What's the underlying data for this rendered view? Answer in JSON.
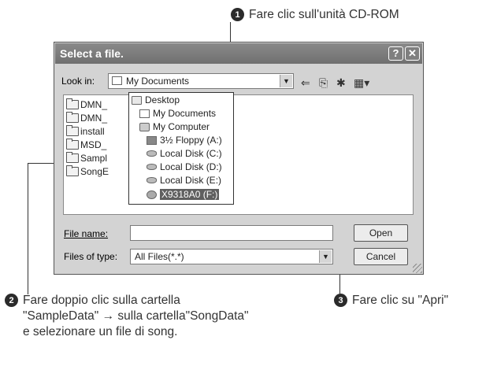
{
  "callouts": [
    {
      "num": "1",
      "text": "Fare clic sull'unità CD-ROM"
    },
    {
      "num": "2",
      "text": "Fare doppio clic sulla cartella \"SampleData\" → sulla cartella\"SongData\" e selezionare un file di song."
    },
    {
      "num": "3",
      "text": "Fare clic su \"Apri\""
    }
  ],
  "dialog": {
    "title": "Select a file.",
    "help_button": "?",
    "close_button": "✕",
    "look_in_label": "Look in:",
    "look_in_value": "My Documents",
    "file_name_label": "File name:",
    "file_name_value": "",
    "files_of_type_label": "Files of type:",
    "files_of_type_value": "All Files(*.*)",
    "open_button": "Open",
    "cancel_button": "Cancel"
  },
  "folders": [
    "DMN_",
    "DMN_",
    "install",
    "MSD_",
    "Sampl",
    "SongE"
  ],
  "dropdown_items": [
    {
      "label": "Desktop",
      "icon": "desktop-icon"
    },
    {
      "label": "My Documents",
      "icon": "documents-folder-icon"
    },
    {
      "label": "My Computer",
      "icon": "computer-icon"
    },
    {
      "label": "3½ Floppy (A:)",
      "icon": "floppy-icon"
    },
    {
      "label": "Local Disk (C:)",
      "icon": "disk-icon"
    },
    {
      "label": "Local Disk (D:)",
      "icon": "disk-icon"
    },
    {
      "label": "Local Disk (E:)",
      "icon": "disk-icon"
    },
    {
      "label": "X9318A0 (F:)",
      "icon": "cdrom-icon",
      "selected": true
    }
  ],
  "toolbar_icons": [
    "back-arrow-icon",
    "up-folder-icon",
    "new-folder-icon",
    "view-menu-icon"
  ]
}
